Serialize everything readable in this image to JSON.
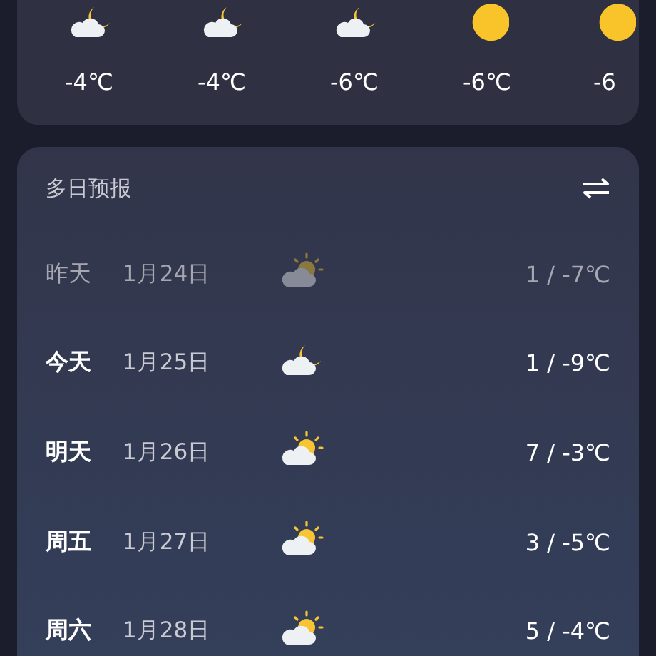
{
  "hourly": [
    {
      "kind": "cloud-moon",
      "temp": "-4℃"
    },
    {
      "kind": "cloud-moon",
      "temp": "-4℃"
    },
    {
      "kind": "cloud-moon",
      "temp": "-6℃"
    },
    {
      "kind": "moon",
      "temp": "-6℃"
    },
    {
      "kind": "moon",
      "temp": "-6"
    }
  ],
  "daily": {
    "title": "多日预报",
    "days": [
      {
        "day": "昨天",
        "date": "1月24日",
        "kind": "cloud-sun",
        "temp": "1 / -7℃",
        "past": true
      },
      {
        "day": "今天",
        "date": "1月25日",
        "kind": "cloud-moon",
        "temp": "1 / -9℃",
        "past": false
      },
      {
        "day": "明天",
        "date": "1月26日",
        "kind": "cloud-sun",
        "temp": "7 / -3℃",
        "past": false
      },
      {
        "day": "周五",
        "date": "1月27日",
        "kind": "cloud-sun",
        "temp": "3 / -5℃",
        "past": false
      },
      {
        "day": "周六",
        "date": "1月28日",
        "kind": "cloud-sun",
        "temp": "5 / -4℃",
        "past": false
      }
    ]
  }
}
